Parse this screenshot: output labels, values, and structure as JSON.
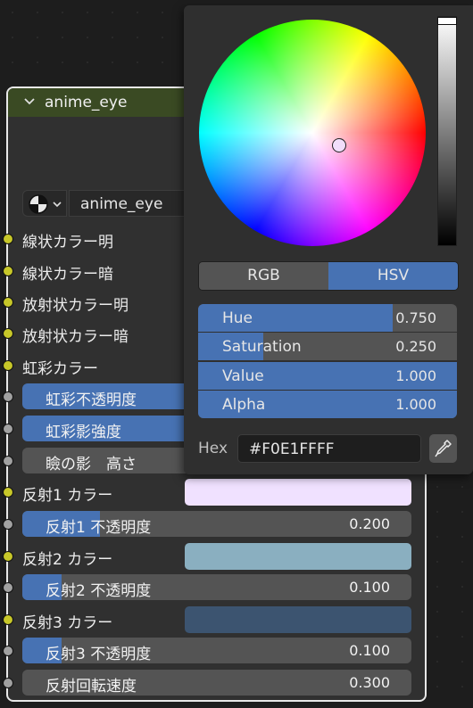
{
  "node": {
    "title": "anime_eye",
    "material_name": "anime_eye",
    "rows": [
      {
        "kind": "label",
        "label": "線状カラー明",
        "socket": "yellow"
      },
      {
        "kind": "label",
        "label": "線状カラー暗",
        "socket": "yellow"
      },
      {
        "kind": "label",
        "label": "放射状カラー明",
        "socket": "yellow"
      },
      {
        "kind": "label",
        "label": "放射状カラー暗",
        "socket": "yellow"
      },
      {
        "kind": "label",
        "label": "虹彩カラー",
        "socket": "yellow"
      },
      {
        "kind": "field",
        "label": "虹彩不透明度",
        "socket": "gray"
      },
      {
        "kind": "field",
        "label": "虹彩影強度",
        "socket": "gray"
      },
      {
        "kind": "field",
        "label": "瞼の影　高さ",
        "socket": "gray"
      },
      {
        "kind": "color",
        "label": "反射1 カラー",
        "socket": "yellow",
        "color": "#F0E1FF"
      },
      {
        "kind": "field",
        "label": "反射1 不透明度",
        "socket": "gray",
        "value": "0.200",
        "fraction": 0.2
      },
      {
        "kind": "color",
        "label": "反射2 カラー",
        "socket": "yellow",
        "color": "#8AAFC0"
      },
      {
        "kind": "field",
        "label": "反射2 不透明度",
        "socket": "gray",
        "value": "0.100",
        "fraction": 0.1
      },
      {
        "kind": "color",
        "label": "反射3 カラー",
        "socket": "yellow",
        "color": "#3C5470"
      },
      {
        "kind": "field",
        "label": "反射3 不透明度",
        "socket": "gray",
        "value": "0.100",
        "fraction": 0.1
      },
      {
        "kind": "field",
        "label": "反射回転速度",
        "socket": "gray",
        "value": "0.300",
        "fraction": 0.0
      }
    ]
  },
  "picker": {
    "modes": [
      "RGB",
      "HSV"
    ],
    "active_mode": "HSV",
    "sliders": [
      {
        "label": "Hue",
        "value": "0.750",
        "fraction": 0.75
      },
      {
        "label": "Saturation",
        "value": "0.250",
        "fraction": 0.25
      },
      {
        "label": "Value",
        "value": "1.000",
        "fraction": 1.0
      },
      {
        "label": "Alpha",
        "value": "1.000",
        "fraction": 1.0
      }
    ],
    "hex_label": "Hex",
    "hex_value": "#F0E1FFFF"
  },
  "colors": {
    "accent": "#4772B3",
    "node_header": "#3A4A23",
    "socket_color": "#C7C729",
    "socket_float": "#A1A1A1"
  }
}
